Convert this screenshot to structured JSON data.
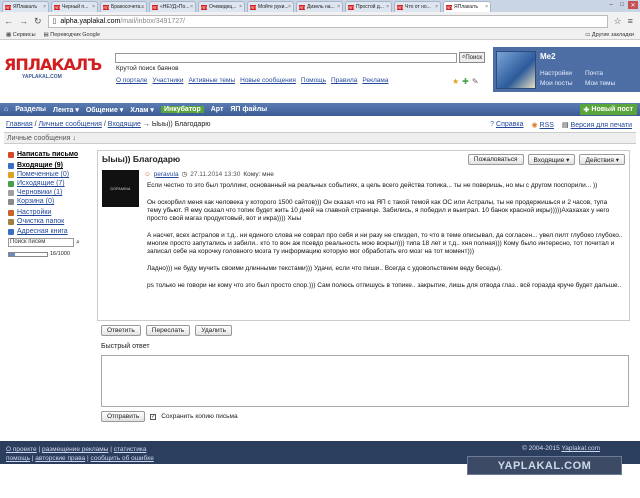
{
  "browser": {
    "tabs": [
      "ЯПлакалъ",
      "Черный п...",
      "Бракосочета...",
      "«НЕУД»По...",
      "Очевидец...",
      "Мойте руки...",
      "Дизель на...",
      "Простой д...",
      "Что от но...",
      "ЯПлакалъ"
    ],
    "active_tab": 9,
    "url_domain": "alpha.yaplakal.com",
    "url_path": "/mail/inbox/3491727/",
    "bookmarks": [
      "Сервисы",
      "Переводчик Google"
    ],
    "bookmarks_right": "Другие закладки"
  },
  "header": {
    "logo": "ЯПЛАКАЛЪ",
    "logo_sub": "YAPLAKAL.COM",
    "search_button": "Поиск",
    "search_hint": "Крутой поиск баянов",
    "nav": [
      "О портале",
      "Участники",
      "Активные темы",
      "Новые сообщения",
      "Помощь",
      "Правила",
      "Реклама"
    ],
    "user": {
      "name": "Me2",
      "links": [
        "Настройки",
        "Почта",
        "Мои посты",
        "Мои темы"
      ]
    }
  },
  "menubar": {
    "items": [
      "Разделы",
      "Лента ▾",
      "Общение ▾",
      "Хлам ▾",
      "Инкубатор",
      "Арт",
      "ЯП файлы"
    ],
    "new_post": "Новый пост"
  },
  "breadcrumb": {
    "items": [
      "Главная",
      "Личные сообщения",
      "Входящие"
    ],
    "current": "Ыыы)) Благодарю",
    "right": [
      "Справка",
      "RSS",
      "Версия для печати"
    ]
  },
  "section_title": "Личные сообщения ↓",
  "sidebar": {
    "compose": "Написать письмо",
    "folders": [
      {
        "label": "Входящие (9)",
        "color": "#3a6fc4",
        "bold": true
      },
      {
        "label": "Помеченные (0)",
        "color": "#e0a020",
        "bold": false
      },
      {
        "label": "Исходящие (7)",
        "color": "#4aa04a",
        "bold": false
      },
      {
        "label": "Черновики (1)",
        "color": "#a0a0a0",
        "bold": false
      },
      {
        "label": "Корзина (0)",
        "color": "#8a8a8a",
        "bold": false
      }
    ],
    "settings": "Настройки",
    "clear": "Очистка папок",
    "address_book": "Адресная книга",
    "search_placeholder": "Поиск писем",
    "quota_value": 0.16,
    "quota_text": "16/1000"
  },
  "message": {
    "subject": "Ыыы)) Благодарю",
    "buttons": [
      "Пожаловаться",
      "Входящие ▾",
      "Действия ▾"
    ],
    "avatar_text": "DOPAMINA",
    "sender": "peravula",
    "date": "27.11.2014 13:30",
    "to": "Кому: мне",
    "paragraphs": [
      "Если честно то это был троллинг, основанный на реальных событиях, а цель всего действа топика... ты не поверишь, но мы с другом поспорили... ))",
      "Он оскорбил меня как человека у которого 1500 сайтов))) Он сказал что на ЯП с такой темой как ОС или Астралы, ты не продержишься и 2 часов, тупа тему убьют. Я ему сказал что топик будет жить 10 дней на главной странице. Забились, я победил и выиграл. 10 банок красной икры)))))Ахахахах у него просто свой магаз продуктовый, вот и икра)))) Хыы",
      "А насчет, всех астралов и т.д.. ни единого слова не соврал про себя и ни разу не спиздел, то что в теме описывал, да согласен... увел пилт глубоко глубоко.. многие просто запутались и забили.. кто то вон аж псевдо реальность мою вскрыл))) типа 18 лет и т.д.. хня полная))) Кому было интересно, тот почитал и записал себе на корочку головного мозга ту информацию которую мог обработать его мозг на тот момент)))",
      "Ладно))) не буду мучить своими длинными текстами))) Удачи, если что пиши.. Всегда с удовольствием веду беседы).",
      "ps только не говори ни кому что это был просто спор.))) Сам полюсь отпишусь в топике.. закрытие, лишь для отвода глаз.. всё горазда круче будет дальше.."
    ],
    "actions": [
      "Ответить",
      "Переслать",
      "Удалить"
    ]
  },
  "quick_reply": {
    "title": "Быстрый ответ",
    "send": "Отправить",
    "save_copy": "Сохранить копию письма"
  },
  "footer": {
    "links_row1": [
      "О проекте",
      "размещение рекламы",
      "статистика"
    ],
    "links_row2": [
      "помощь",
      "авторские права",
      "сообщить об ошибке"
    ],
    "copyright": "© 2004-2015",
    "site": "Yaplakal.com",
    "watermark": "YAPLAKAL.COM"
  }
}
